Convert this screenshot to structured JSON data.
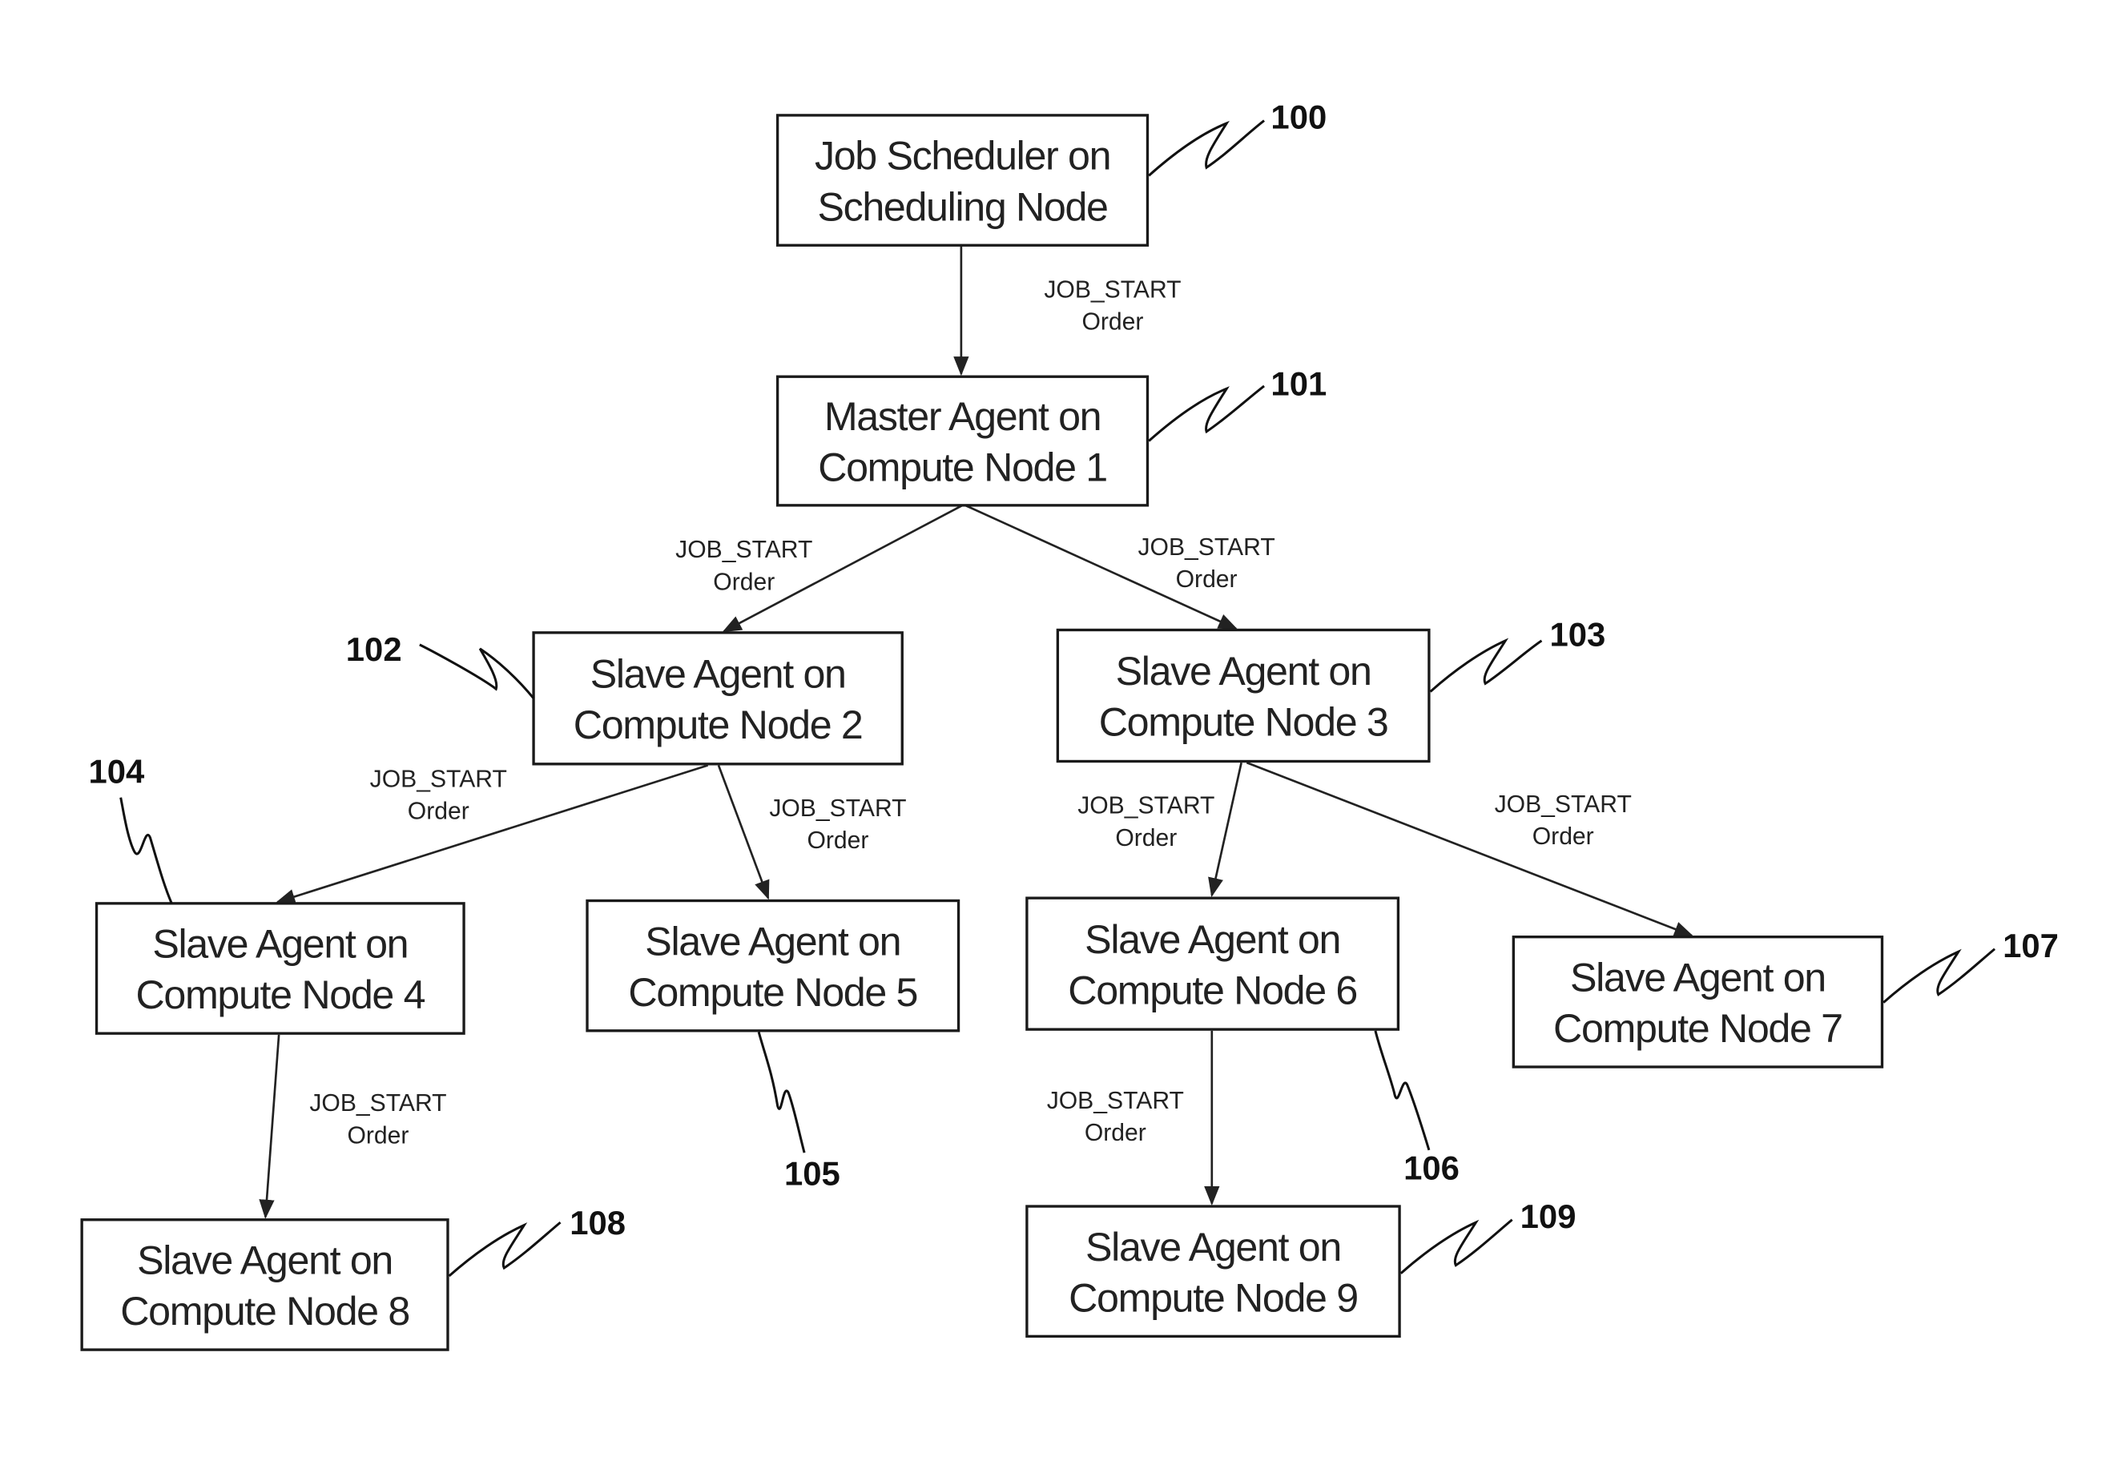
{
  "figure": {
    "nodes": [
      {
        "id": "100",
        "ref": "100",
        "lines": [
          "Job Scheduler on",
          "Scheduling Node"
        ]
      },
      {
        "id": "101",
        "ref": "101",
        "lines": [
          "Master Agent on",
          "Compute Node 1"
        ]
      },
      {
        "id": "102",
        "ref": "102",
        "lines": [
          "Slave Agent on",
          "Compute Node 2"
        ]
      },
      {
        "id": "103",
        "ref": "103",
        "lines": [
          "Slave Agent on",
          "Compute Node 3"
        ]
      },
      {
        "id": "104",
        "ref": "104",
        "lines": [
          "Slave Agent on",
          "Compute Node 4"
        ]
      },
      {
        "id": "105",
        "ref": "105",
        "lines": [
          "Slave Agent on",
          "Compute Node 5"
        ]
      },
      {
        "id": "106",
        "ref": "106",
        "lines": [
          "Slave Agent on",
          "Compute Node 6"
        ]
      },
      {
        "id": "107",
        "ref": "107",
        "lines": [
          "Slave Agent on",
          "Compute Node 7"
        ]
      },
      {
        "id": "108",
        "ref": "108",
        "lines": [
          "Slave Agent on",
          "Compute Node 8"
        ]
      },
      {
        "id": "109",
        "ref": "109",
        "lines": [
          "Slave Agent on",
          "Compute Node 9"
        ]
      }
    ],
    "edges": [
      {
        "from": "100",
        "to": "101",
        "label": [
          "JOB_START",
          "Order"
        ]
      },
      {
        "from": "101",
        "to": "102",
        "label": [
          "JOB_START",
          "Order"
        ]
      },
      {
        "from": "101",
        "to": "103",
        "label": [
          "JOB_START",
          "Order"
        ]
      },
      {
        "from": "102",
        "to": "104",
        "label": [
          "JOB_START",
          "Order"
        ]
      },
      {
        "from": "102",
        "to": "105",
        "label": [
          "JOB_START",
          "Order"
        ]
      },
      {
        "from": "103",
        "to": "106",
        "label": [
          "JOB_START",
          "Order"
        ]
      },
      {
        "from": "103",
        "to": "107",
        "label": [
          "JOB_START",
          "Order"
        ]
      },
      {
        "from": "104",
        "to": "108",
        "label": [
          "JOB_START",
          "Order"
        ]
      },
      {
        "from": "106",
        "to": "109",
        "label": [
          "JOB_START",
          "Order"
        ]
      }
    ]
  }
}
